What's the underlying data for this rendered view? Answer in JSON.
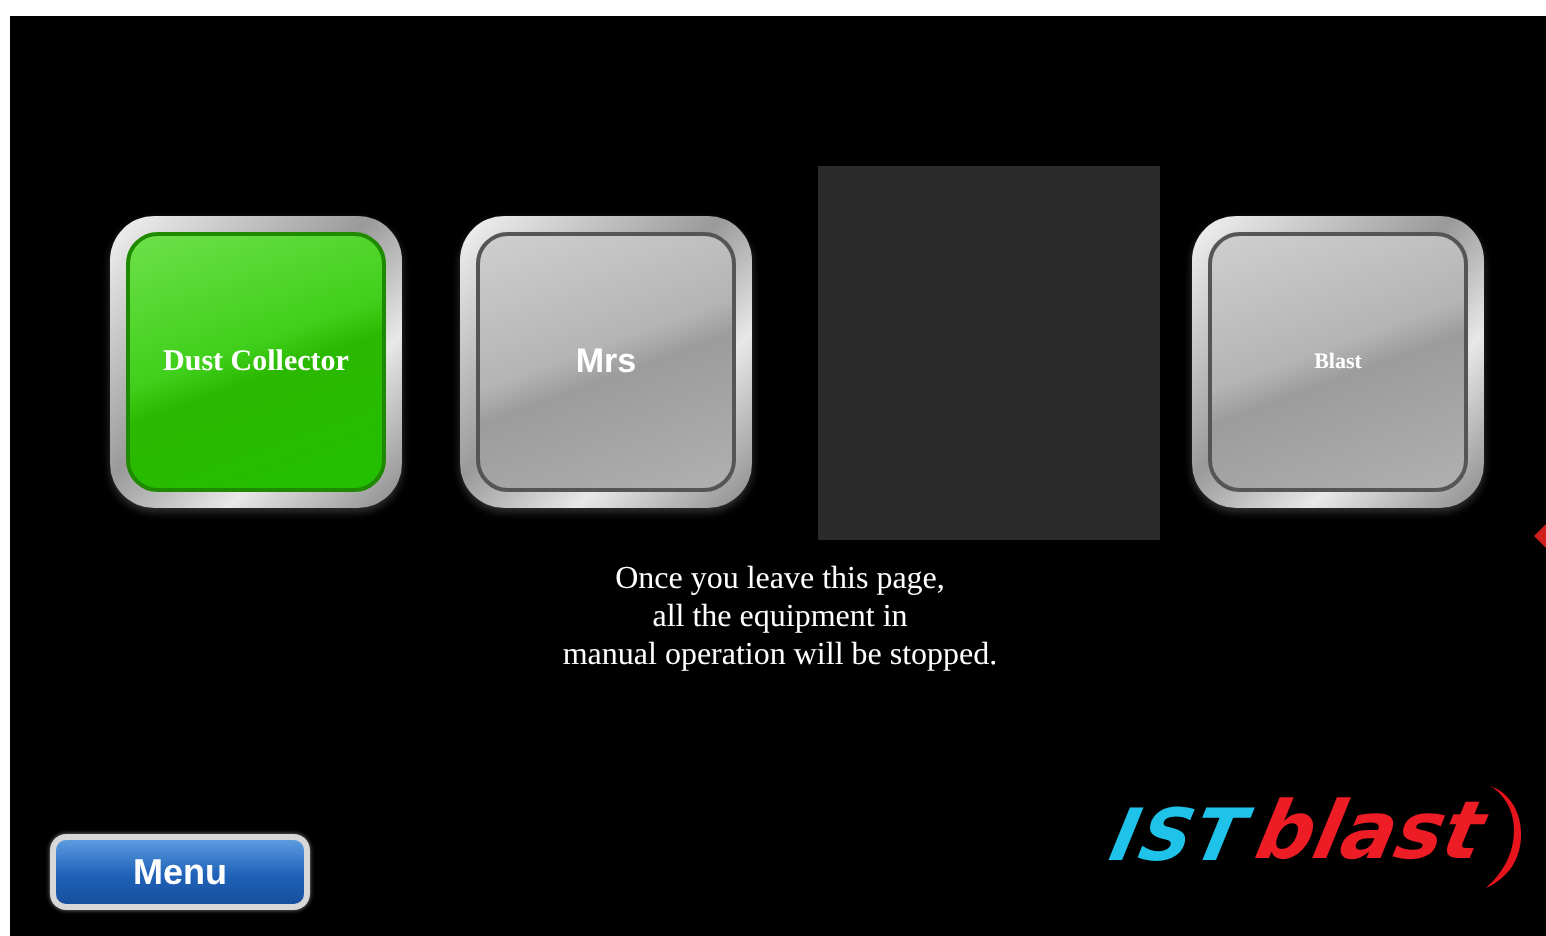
{
  "tiles": [
    {
      "kind": "button",
      "label": "Dust Collector",
      "on": true
    },
    {
      "kind": "button",
      "label": "Mrs",
      "on": false
    },
    {
      "kind": "blank"
    },
    {
      "kind": "button",
      "label": "Blast",
      "on": false
    }
  ],
  "message": [
    "Once you leave this page,",
    "all the equipment in",
    "manual operation will be stopped."
  ],
  "menu_button": "Menu",
  "logo": {
    "part_1": "IST",
    "part_2": "blast"
  }
}
